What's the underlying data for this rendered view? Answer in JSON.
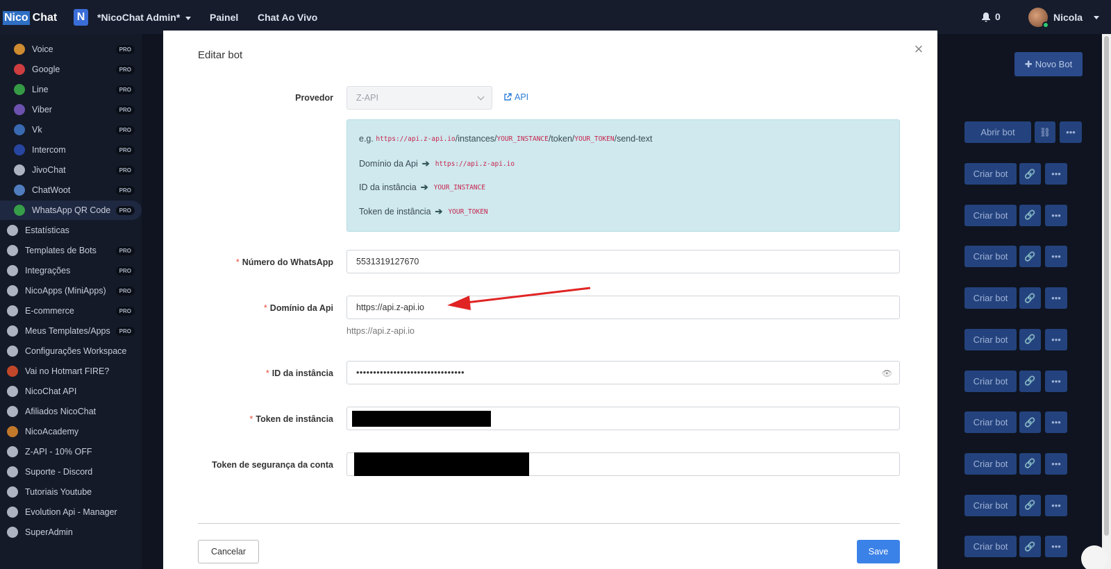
{
  "topbar": {
    "logo_a": "Nico",
    "logo_b": "Chat",
    "workspace_badge": "N",
    "workspace_name": "*NicoChat Admin*",
    "nav": [
      "Painel",
      "Chat Ao Vivo"
    ],
    "notifications": "0",
    "user_name": "Nicola"
  },
  "sidebar": {
    "items": [
      {
        "label": "Voice",
        "pro": "PRO",
        "icon": "phone-icon",
        "color": "#f0a030"
      },
      {
        "label": "Google",
        "pro": "PRO",
        "icon": "google-icon",
        "color": "#e44"
      },
      {
        "label": "Line",
        "pro": "PRO",
        "icon": "line-icon",
        "color": "#3bb34a"
      },
      {
        "label": "Viber",
        "pro": "PRO",
        "icon": "viber-icon",
        "color": "#7d5cc6"
      },
      {
        "label": "Vk",
        "pro": "PRO",
        "icon": "vk-icon",
        "color": "#3f78c8"
      },
      {
        "label": "Intercom",
        "pro": "PRO",
        "icon": "intercom-icon",
        "color": "#2a4fb5"
      },
      {
        "label": "JivoChat",
        "pro": "PRO",
        "icon": "jivochat-icon",
        "color": "#c8cfdc"
      },
      {
        "label": "ChatWoot",
        "pro": "PRO",
        "icon": "chatwoot-icon",
        "color": "#5a8fd8"
      },
      {
        "label": "WhatsApp QR Code",
        "pro": "PRO",
        "icon": "whatsapp-icon",
        "color": "#3bb34a"
      },
      {
        "label": "Estatísticas",
        "pro": "",
        "icon": "chart-icon",
        "color": "#c8cfdc"
      },
      {
        "label": "Templates de Bots",
        "pro": "PRO",
        "icon": "template-icon",
        "color": "#c8cfdc"
      },
      {
        "label": "Integrações",
        "pro": "PRO",
        "icon": "integrations-icon",
        "color": "#c8cfdc"
      },
      {
        "label": "NicoApps (MiniApps)",
        "pro": "PRO",
        "icon": "user-icon",
        "color": "#c8cfdc"
      },
      {
        "label": "E-commerce",
        "pro": "PRO",
        "icon": "cart-icon",
        "color": "#c8cfdc"
      },
      {
        "label": "Meus Templates/Apps",
        "pro": "PRO",
        "icon": "document-icon",
        "color": "#c8cfdc"
      },
      {
        "label": "Configurações Workspace",
        "pro": "",
        "icon": "gear-icon",
        "color": "#c8cfdc"
      },
      {
        "label": "Vai no Hotmart FIRE?",
        "pro": "",
        "icon": "fire-icon",
        "color": "#e0502a"
      },
      {
        "label": "NicoChat API",
        "pro": "",
        "icon": "api-icon",
        "color": "#c8cfdc"
      },
      {
        "label": "Afiliados NicoChat",
        "pro": "",
        "icon": "affiliates-icon",
        "color": "#c8cfdc"
      },
      {
        "label": "NicoAcademy",
        "pro": "",
        "icon": "academy-icon",
        "color": "#e08a2a"
      },
      {
        "label": "Z-API - 10% OFF",
        "pro": "",
        "icon": "zapi-icon",
        "color": "#c8cfdc"
      },
      {
        "label": "Suporte - Discord",
        "pro": "",
        "icon": "discord-icon",
        "color": "#c8cfdc"
      },
      {
        "label": "Tutoriais Youtube",
        "pro": "",
        "icon": "youtube-icon",
        "color": "#c8cfdc"
      },
      {
        "label": "Evolution Api - Manager",
        "pro": "",
        "icon": "chat-icon",
        "color": "#c8cfdc"
      },
      {
        "label": "SuperAdmin",
        "pro": "",
        "icon": "handshake-icon",
        "color": "#c8cfdc"
      }
    ]
  },
  "background": {
    "new_bot_label": "Novo Bot",
    "open_bot_label": "Abrir bot",
    "create_bot_label": "Criar bot"
  },
  "modal": {
    "title": "Editar bot",
    "provider_label": "Provedor",
    "provider_value": "Z-API",
    "api_link": "API",
    "info": {
      "example_prefix": "e.g.",
      "example_url_a": "https://api.z-api.io",
      "example_url_b": "/instances/",
      "example_url_c": "YOUR_INSTANCE",
      "example_url_d": "/token/",
      "example_url_e": "YOUR_TOKEN",
      "example_url_f": "/send-text",
      "domain_label": "Domínio da Api",
      "domain_value": "https://api.z-api.io",
      "instance_label": "ID da instância",
      "instance_value": "YOUR_INSTANCE",
      "token_label": "Token de instância",
      "token_value": "YOUR_TOKEN"
    },
    "whatsapp_label": "Número do WhatsApp",
    "whatsapp_value": "5531319127670",
    "domain_label": "Domínio da Api",
    "domain_value": "https://api.z-api.io",
    "domain_hint": "https://api.z-api.io",
    "instance_label": "ID da instância",
    "instance_value": "••••••••••••••••••••••••••••••••",
    "token_label": "Token de instância",
    "security_label": "Token de segurança da conta",
    "required_mark": "*",
    "cancel_label": "Cancelar",
    "save_label": "Save"
  }
}
